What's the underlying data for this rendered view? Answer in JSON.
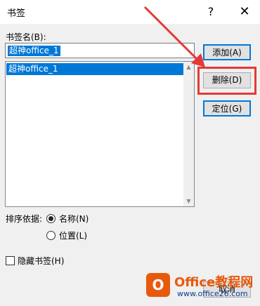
{
  "dialog": {
    "title": "书签",
    "help_label": "?",
    "close_label": "✕"
  },
  "bookmark_name": {
    "label": "书签名(B):",
    "value": "超神office_1"
  },
  "bookmark_list": {
    "items": [
      "超神office_1"
    ],
    "selected_index": 0
  },
  "buttons": {
    "add": "添加(A)",
    "delete": "删除(D)",
    "goto": "定位(G)",
    "cancel": "取消"
  },
  "sort": {
    "label": "排序依据:",
    "options": [
      "名称(N)",
      "位置(L)"
    ],
    "selected": "名称(N)"
  },
  "hidden_bookmarks": {
    "label": "隐藏书签(H)",
    "checked": false
  },
  "watermark": {
    "logo_glyph": "O",
    "text": "Office教程网",
    "url": "www.office26.com"
  },
  "annotation": {
    "highlight_color": "#e53935",
    "arrow_color": "#e53935"
  }
}
